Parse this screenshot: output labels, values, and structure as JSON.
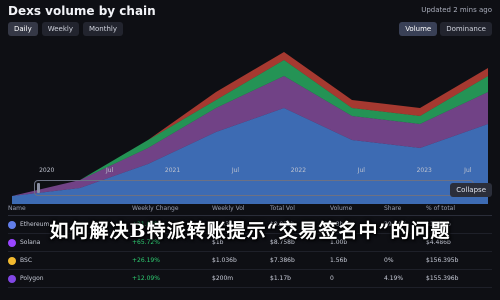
{
  "header": {
    "title": "Dexs volume by chain",
    "updated": "Updated 2 mins ago"
  },
  "tabs": [
    {
      "label": "Daily"
    },
    {
      "label": "Weekly"
    },
    {
      "label": "Monthly"
    }
  ],
  "toggle": [
    {
      "label": "Volume"
    },
    {
      "label": "Dominance"
    }
  ],
  "axis": {
    "labels": [
      "2020",
      "Jul",
      "2021",
      "Jul",
      "2022",
      "Jul",
      "2023",
      "Jul"
    ]
  },
  "controls": {
    "collapse_label": "Collapse"
  },
  "table": {
    "headers": [
      "Name",
      "Weekly Change",
      "Weekly Vol",
      "Total Vol",
      "Volume",
      "Share",
      "% of total"
    ],
    "rows": [
      {
        "name": "Ethereum",
        "c1": "+21.62%",
        "c2": "$1.434b",
        "c3": "$9.928b",
        "c4": "1.3b",
        "c5": "29.84%",
        "c6": "$1.519b"
      },
      {
        "name": "Solana",
        "c1": "+65.72%",
        "c2": "$1b",
        "c3": "$8.758b",
        "c4": "1.00b",
        "c5": "",
        "c6": "$4.486b"
      },
      {
        "name": "BSC",
        "c1": "+26.19%",
        "c2": "$1.036b",
        "c3": "$7.386b",
        "c4": "1.56b",
        "c5": "0%",
        "c6": "$156.395b"
      },
      {
        "name": "Polygon",
        "c1": "+12.09%",
        "c2": "$200m",
        "c3": "$1.17b",
        "c4": "0",
        "c5": "4.19%",
        "c6": "$155.396b"
      }
    ]
  },
  "overlay": {
    "text": "如何解决B特派转账提示“交易签名中”的问题"
  },
  "colors": {
    "background": "#0e0f14",
    "chart_main": "#4d8be8",
    "chart_alt1": "#9b59b6",
    "chart_alt2": "#2ecc71",
    "chart_alt3": "#e74c3c",
    "positive": "#2ecc71"
  },
  "chart_data": {
    "type": "area",
    "title": "Dexs volume by chain",
    "x": [
      "2020",
      "Jul",
      "2021",
      "Jul",
      "2022",
      "Jul",
      "2023",
      "Jul"
    ],
    "series": [
      {
        "values": [
          1,
          2,
          5,
          9,
          12,
          8,
          7,
          10
        ]
      },
      {
        "values": [
          0,
          1,
          2,
          3,
          4,
          3,
          3,
          4
        ]
      },
      {
        "values": [
          0,
          0,
          1,
          1,
          2,
          1,
          1,
          2
        ]
      },
      {
        "values": [
          0,
          0,
          0,
          1,
          1,
          1,
          1,
          1
        ]
      }
    ],
    "grid": false
  }
}
